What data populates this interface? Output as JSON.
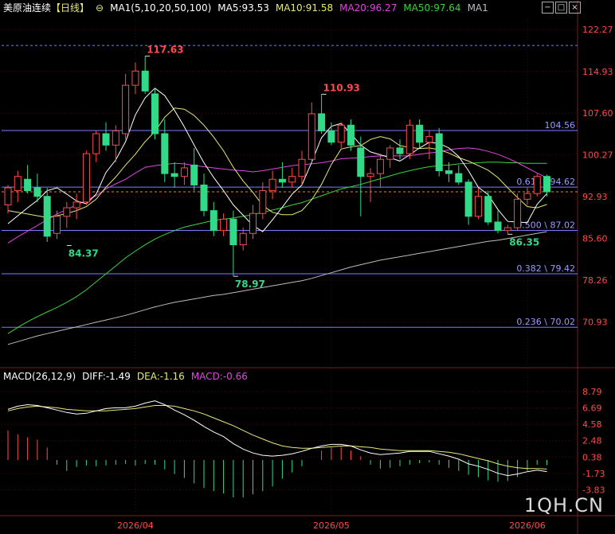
{
  "header": {
    "symbol": "美原油连续",
    "period": "【日线】",
    "ma_title": "MA1(5,10,20,50,100)",
    "ma5": "MA5:93.53",
    "ma10": "MA10:91.58",
    "ma20": "MA20:96.27",
    "ma50": "MA50:97.64",
    "ma100": "MA1"
  },
  "macd_header": {
    "title": "MACD(26,12,9)",
    "diff": "DIFF:-1.49",
    "dea": "DEA:-1.16",
    "macd": "MACD:-0.66"
  },
  "watermark": "1QH.CN",
  "toolbar_icons": [
    "minus-icon",
    "square-icon",
    "close-icon"
  ],
  "colors": {
    "up": "#ff4a4a",
    "down": "#33d989",
    "ma5": "#ffffff",
    "ma10": "#e8e878",
    "ma20": "#e046e0",
    "ma50": "#3ad43a",
    "ma100": "#bbbbbb",
    "fib": "#7b7bff",
    "axis": "#ff4a4a",
    "diff": "#ffffff",
    "dea": "#e8e878"
  },
  "chart_data": [
    {
      "type": "candlestick",
      "title": "美原油连续【日线】",
      "y_ticks": [
        "122.27",
        "114.93",
        "107.60",
        "100.27",
        "92.93",
        "85.60",
        "78.26",
        "70.93"
      ],
      "ylim": [
        66.0,
        124.4
      ],
      "x_ticks": [
        {
          "label": "2026/04",
          "index": 13
        },
        {
          "label": "2026/05",
          "index": 33
        },
        {
          "label": "2026/06",
          "index": 53
        }
      ],
      "candles": [
        [
          91.5,
          95.0,
          90.0,
          94.5
        ],
        [
          94.0,
          97.5,
          92.0,
          96.5
        ],
        [
          96.0,
          98.5,
          93.5,
          94.0
        ],
        [
          94.5,
          97.0,
          92.0,
          93.0
        ],
        [
          93.0,
          94.5,
          85.0,
          86.0
        ],
        [
          86.5,
          90.5,
          85.5,
          89.5
        ],
        [
          89.5,
          92.0,
          87.5,
          91.0
        ],
        [
          91.0,
          93.5,
          89.0,
          92.0
        ],
        [
          92.0,
          101.0,
          91.5,
          100.5
        ],
        [
          100.5,
          104.5,
          99.0,
          104.0
        ],
        [
          104.0,
          106.0,
          101.0,
          102.0
        ],
        [
          102.0,
          105.5,
          99.0,
          104.5
        ],
        [
          104.0,
          114.5,
          103.0,
          112.5
        ],
        [
          112.5,
          116.5,
          111.0,
          115.0
        ],
        [
          115.0,
          117.63,
          111.0,
          111.5
        ],
        [
          111.0,
          112.0,
          103.0,
          104.0
        ],
        [
          104.0,
          106.5,
          95.5,
          97.0
        ],
        [
          97.0,
          99.0,
          94.5,
          96.5
        ],
        [
          96.5,
          99.0,
          95.0,
          98.0
        ],
        [
          98.5,
          101.5,
          94.0,
          95.0
        ],
        [
          95.0,
          97.0,
          89.5,
          90.5
        ],
        [
          90.5,
          92.0,
          86.0,
          87.0
        ],
        [
          87.0,
          90.0,
          86.0,
          89.0
        ],
        [
          89.0,
          90.5,
          79.0,
          84.5
        ],
        [
          84.5,
          87.5,
          83.5,
          86.5
        ],
        [
          86.5,
          91.5,
          85.5,
          90.0
        ],
        [
          90.0,
          95.5,
          89.0,
          94.0
        ],
        [
          94.0,
          97.5,
          92.5,
          96.0
        ],
        [
          96.0,
          99.0,
          94.5,
          95.5
        ],
        [
          95.5,
          98.0,
          94.5,
          96.5
        ],
        [
          96.5,
          101.0,
          95.0,
          99.5
        ],
        [
          99.5,
          109.5,
          99.0,
          107.5
        ],
        [
          107.5,
          110.93,
          104.0,
          104.5
        ],
        [
          104.5,
          106.0,
          102.0,
          102.5
        ],
        [
          102.5,
          106.0,
          101.5,
          105.5
        ],
        [
          105.5,
          106.5,
          101.0,
          102.0
        ],
        [
          101.5,
          103.5,
          89.5,
          96.5
        ],
        [
          96.5,
          98.0,
          92.0,
          97.0
        ],
        [
          97.0,
          100.5,
          94.5,
          99.5
        ],
        [
          99.5,
          102.0,
          98.0,
          101.5
        ],
        [
          101.5,
          103.0,
          99.5,
          100.5
        ],
        [
          100.5,
          106.5,
          99.5,
          105.5
        ],
        [
          105.5,
          106.5,
          101.5,
          102.5
        ],
        [
          102.5,
          104.5,
          99.5,
          103.5
        ],
        [
          104.0,
          105.0,
          96.5,
          97.5
        ],
        [
          97.5,
          99.0,
          95.5,
          97.0
        ],
        [
          97.0,
          98.5,
          95.0,
          95.5
        ],
        [
          95.5,
          96.0,
          88.0,
          89.5
        ],
        [
          89.5,
          94.5,
          89.0,
          93.0
        ],
        [
          93.0,
          94.0,
          88.0,
          88.5
        ],
        [
          88.5,
          90.5,
          86.5,
          87.0
        ],
        [
          87.0,
          88.0,
          86.35,
          87.5
        ],
        [
          87.5,
          93.5,
          87.0,
          92.5
        ],
        [
          92.5,
          94.5,
          91.5,
          93.5
        ],
        [
          93.5,
          97.0,
          93.0,
          96.5
        ],
        [
          96.5,
          96.8,
          93.0,
          93.8
        ]
      ],
      "ma5": [
        88.2,
        89.6,
        91.0,
        92.3,
        94.0,
        94.5,
        93.4,
        92.2,
        91.7,
        93.4,
        97.2,
        99.4,
        102.6,
        107.3,
        110.3,
        112.0,
        110.7,
        108.1,
        105.2,
        102.0,
        98.9,
        96.3,
        94.0,
        91.5,
        89.7,
        87.9,
        86.8,
        88.9,
        91.1,
        93.4,
        95.0,
        99.0,
        103.3,
        105.3,
        105.8,
        104.0,
        102.0,
        100.8,
        100.3,
        99.8,
        99.2,
        100.3,
        101.5,
        102.5,
        102.3,
        101.5,
        100.0,
        97.5,
        94.6,
        93.3,
        90.7,
        88.6,
        88.5,
        88.4,
        91.6,
        93.5
      ],
      "ma10": [
        90.5,
        90.2,
        89.9,
        89.6,
        89.3,
        89.6,
        90.0,
        90.5,
        91.2,
        92.5,
        94.6,
        96.4,
        98.5,
        100.4,
        102.6,
        104.4,
        106.9,
        108.5,
        108.3,
        107.2,
        105.5,
        103.4,
        101.0,
        98.1,
        95.7,
        93.7,
        91.4,
        90.2,
        89.8,
        89.8,
        90.5,
        92.4,
        95.1,
        98.6,
        101.3,
        101.7,
        101.9,
        103.0,
        103.5,
        103.1,
        101.9,
        101.6,
        101.4,
        101.5,
        101.2,
        100.6,
        99.8,
        99.2,
        98.4,
        97.6,
        96.3,
        94.5,
        92.8,
        91.2,
        91.0,
        91.58
      ],
      "ma20": [
        84.8,
        85.9,
        86.9,
        87.9,
        88.9,
        89.9,
        90.7,
        91.5,
        92.3,
        93.1,
        94.3,
        95.2,
        96.0,
        97.1,
        98.1,
        98.4,
        98.6,
        98.8,
        98.7,
        98.4,
        98.2,
        98.0,
        97.8,
        97.6,
        97.5,
        97.3,
        97.5,
        97.8,
        98.1,
        98.4,
        98.6,
        98.7,
        98.9,
        99.2,
        99.6,
        99.7,
        99.8,
        100.0,
        100.1,
        100.1,
        100.1,
        100.1,
        100.4,
        100.6,
        100.8,
        101.2,
        101.4,
        101.5,
        101.3,
        100.9,
        100.4,
        99.7,
        98.9,
        98.0,
        97.1,
        96.27
      ],
      "ma50": [
        68.9,
        70.0,
        71.0,
        71.9,
        72.7,
        73.5,
        74.4,
        75.4,
        76.6,
        78.0,
        79.4,
        80.8,
        82.2,
        83.4,
        84.5,
        85.5,
        86.3,
        87.0,
        87.6,
        88.0,
        88.4,
        88.8,
        89.0,
        89.2,
        89.5,
        89.8,
        90.2,
        90.6,
        91.0,
        91.5,
        91.9,
        92.5,
        93.1,
        93.7,
        94.3,
        94.7,
        95.1,
        95.6,
        96.1,
        96.6,
        97.1,
        97.5,
        97.9,
        98.2,
        98.4,
        98.5,
        98.7,
        98.8,
        98.9,
        99.0,
        99.0,
        98.9,
        98.9,
        98.8,
        98.8,
        98.8
      ],
      "ma100": [
        67.0,
        67.5,
        68.0,
        68.5,
        68.9,
        69.3,
        69.7,
        70.1,
        70.5,
        70.9,
        71.3,
        71.7,
        72.1,
        72.6,
        73.1,
        73.6,
        74.0,
        74.4,
        74.7,
        75.0,
        75.3,
        75.6,
        75.8,
        76.1,
        76.4,
        76.7,
        77.0,
        77.3,
        77.6,
        77.9,
        78.2,
        78.6,
        79.1,
        79.6,
        80.1,
        80.6,
        81.0,
        81.4,
        81.8,
        82.1,
        82.4,
        82.7,
        83.0,
        83.3,
        83.6,
        83.9,
        84.2,
        84.5,
        84.8,
        85.1,
        85.3,
        85.6,
        85.9,
        86.2,
        86.5,
        86.8
      ],
      "annotations": [
        {
          "label": "117.63",
          "index": 14,
          "value": 117.63,
          "side": "high"
        },
        {
          "label": "110.93",
          "index": 32,
          "value": 110.93,
          "side": "high"
        },
        {
          "label": "84.37",
          "index": 6,
          "value": 84.37,
          "side": "low"
        },
        {
          "label": "78.97",
          "index": 23,
          "value": 78.97,
          "side": "low"
        },
        {
          "label": "86.35",
          "index": 51,
          "value": 86.35,
          "side": "low"
        }
      ],
      "fib_levels": [
        {
          "value": 119.5,
          "label": ""
        },
        {
          "value": 104.56,
          "label": "104.56"
        },
        {
          "value": 94.62,
          "label": "0.618 \\ 94.62"
        },
        {
          "value": 87.02,
          "label": "0.500 \\ 87.02"
        },
        {
          "value": 79.42,
          "label": "0.382 \\ 79.42"
        },
        {
          "value": 70.02,
          "label": "0.236 \\ 70.02"
        }
      ],
      "last_close": 93.8
    },
    {
      "type": "macd",
      "title": "MACD(26,12,9)",
      "y_ticks": [
        "8.79",
        "6.69",
        "4.58",
        "2.48",
        "0.38",
        "-1.73",
        "-3.83"
      ],
      "ylim": [
        -4.9,
        9.6
      ],
      "diff": [
        6.5,
        6.9,
        7.1,
        7.0,
        6.7,
        6.4,
        6.1,
        5.9,
        6.0,
        6.3,
        6.6,
        6.7,
        6.7,
        6.9,
        7.3,
        7.6,
        7.1,
        6.4,
        5.8,
        5.1,
        4.3,
        3.6,
        3.0,
        2.1,
        1.4,
        0.9,
        0.6,
        0.5,
        0.6,
        0.8,
        1.1,
        1.5,
        1.8,
        2.0,
        2.0,
        1.8,
        1.3,
        0.9,
        0.7,
        0.8,
        0.9,
        1.1,
        1.1,
        1.1,
        0.8,
        0.5,
        0.1,
        -0.5,
        -0.8,
        -1.2,
        -1.7,
        -2.0,
        -1.8,
        -1.5,
        -1.3,
        -1.49
      ],
      "dea": [
        6.3,
        6.6,
        6.8,
        6.9,
        6.8,
        6.7,
        6.5,
        6.4,
        6.3,
        6.3,
        6.3,
        6.4,
        6.5,
        6.6,
        6.8,
        7.0,
        7.0,
        6.9,
        6.6,
        6.3,
        5.9,
        5.4,
        4.9,
        4.4,
        3.8,
        3.2,
        2.7,
        2.2,
        1.8,
        1.6,
        1.5,
        1.5,
        1.6,
        1.7,
        1.8,
        1.8,
        1.7,
        1.6,
        1.4,
        1.3,
        1.2,
        1.2,
        1.2,
        1.2,
        1.1,
        1.0,
        0.8,
        0.5,
        0.2,
        -0.1,
        -0.5,
        -0.8,
        -1.0,
        -1.1,
        -1.1,
        -1.16
      ],
      "hist": [
        3.8,
        3.3,
        2.9,
        2.6,
        1.6,
        -0.6,
        -1.4,
        -0.9,
        -0.7,
        -0.8,
        -0.7,
        -0.6,
        -0.5,
        -0.7,
        -0.5,
        -0.6,
        -1.2,
        -1.8,
        -2.3,
        -3.0,
        -3.6,
        -4.0,
        -4.3,
        -4.8,
        -4.8,
        -4.4,
        -4.0,
        -3.4,
        -2.4,
        -1.6,
        -0.8,
        0.0,
        1.2,
        1.6,
        1.7,
        1.2,
        0.5,
        -0.6,
        -1.1,
        -1.0,
        -0.8,
        -0.6,
        -0.4,
        -0.3,
        -0.6,
        -1.0,
        -1.4,
        -1.9,
        -2.2,
        -2.6,
        -2.8,
        -2.7,
        -2.2,
        -1.4,
        -0.6,
        -0.66
      ]
    }
  ]
}
